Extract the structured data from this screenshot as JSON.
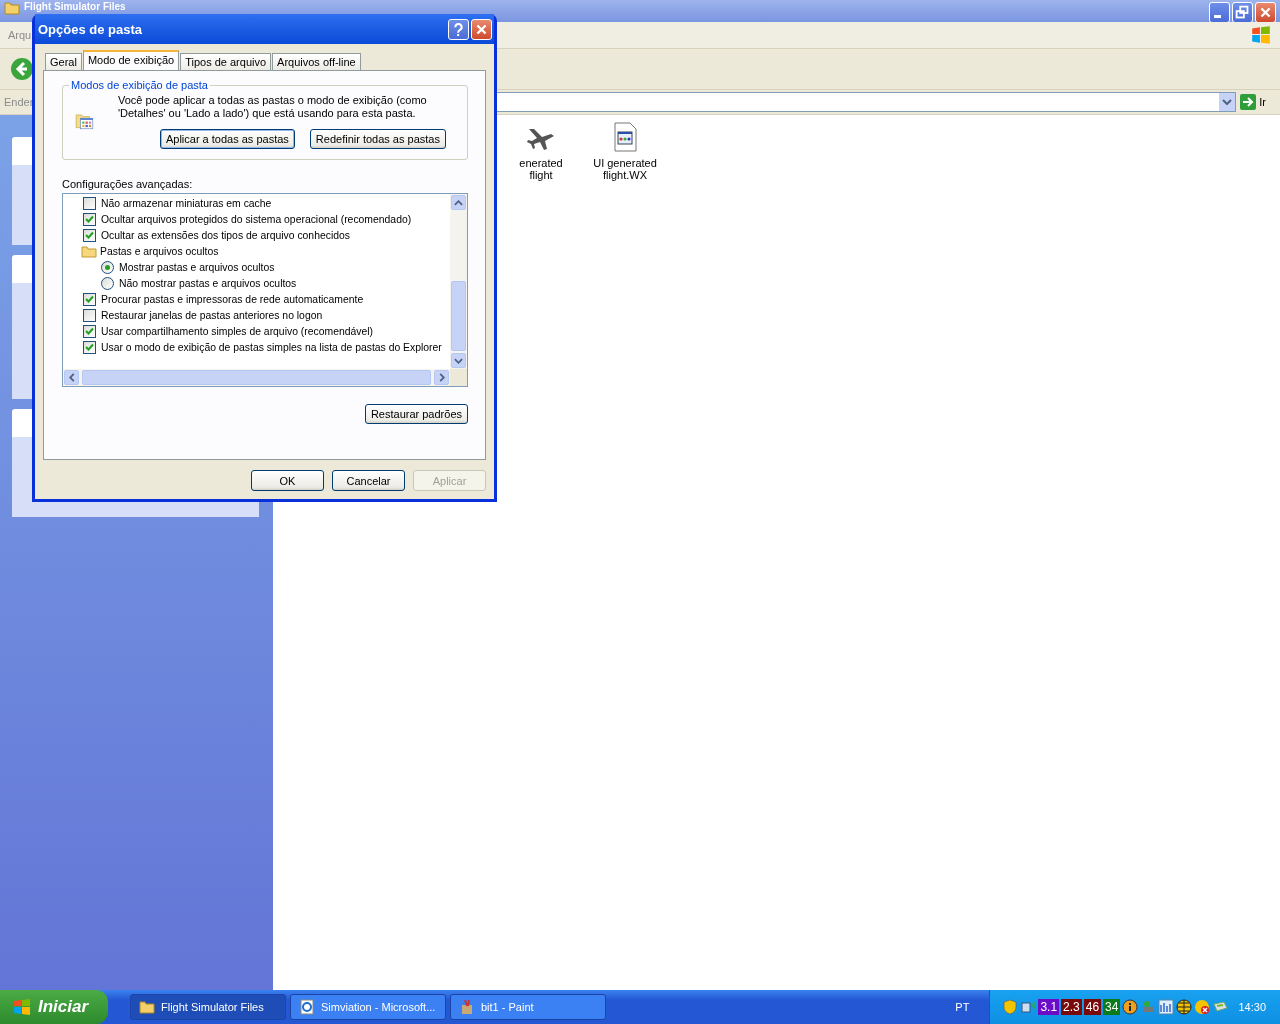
{
  "explorer": {
    "title": "Flight Simulator Files",
    "menu_fragment": "Arqu",
    "address_label": "Ender",
    "go_label": "Ir",
    "files": [
      {
        "name": "enerated flight",
        "kind": "plane"
      },
      {
        "name": "UI generated flight.WX",
        "kind": "document"
      }
    ]
  },
  "dialog": {
    "title": "Opções de pasta",
    "tabs": [
      {
        "label": "Geral",
        "selected": false
      },
      {
        "label": "Modo de exibição",
        "selected": true
      },
      {
        "label": "Tipos de arquivo",
        "selected": false
      },
      {
        "label": "Arquivos off-line",
        "selected": false
      }
    ],
    "group_title": "Modos de exibição de pasta",
    "group_text": "Você pode aplicar a todas as pastas o modo de exibição (como 'Detalhes' ou 'Lado a lado') que está usando para esta pasta.",
    "group_buttons": [
      {
        "label": "Aplicar a todas as pastas",
        "default": true
      },
      {
        "label": "Redefinir todas as pastas",
        "default": false
      }
    ],
    "advanced_label": "Configurações avançadas:",
    "settings": [
      {
        "kind": "checkbox",
        "label": "Não armazenar miniaturas em cache",
        "checked": false
      },
      {
        "kind": "checkbox",
        "label": "Ocultar arquivos protegidos do sistema operacional (recomendado)",
        "checked": true
      },
      {
        "kind": "checkbox",
        "label": "Ocultar as extensões dos tipos de arquivo conhecidos",
        "checked": true
      },
      {
        "kind": "folder",
        "label": "Pastas e arquivos ocultos",
        "children": [
          {
            "kind": "radio",
            "label": "Mostrar pastas e arquivos ocultos",
            "selected": true
          },
          {
            "kind": "radio",
            "label": "Não mostrar pastas e arquivos ocultos",
            "selected": false
          }
        ]
      },
      {
        "kind": "checkbox",
        "label": "Procurar pastas e impressoras de rede automaticamente",
        "checked": true
      },
      {
        "kind": "checkbox",
        "label": "Restaurar janelas de pastas anteriores no logon",
        "checked": false
      },
      {
        "kind": "checkbox",
        "label": "Usar compartilhamento simples de arquivo (recomendável)",
        "checked": true
      },
      {
        "kind": "checkbox",
        "label": "Usar o modo de exibição de pastas simples na lista de pastas do Explorer",
        "checked": true
      }
    ],
    "restore_button": "Restaurar padrões",
    "buttons": [
      {
        "label": "OK",
        "disabled": false
      },
      {
        "label": "Cancelar",
        "disabled": false
      },
      {
        "label": "Aplicar",
        "disabled": true
      }
    ]
  },
  "taskbar": {
    "start": "Iniciar",
    "tasks": [
      {
        "label": "Flight Simulator Files",
        "kind": "folder",
        "selected": true
      },
      {
        "label": "Simviation - Microsoft...",
        "kind": "browser",
        "selected": false
      },
      {
        "label": "bit1 - Paint",
        "kind": "paint",
        "selected": false
      }
    ],
    "language": "PT",
    "tray_badges": [
      {
        "text": "3.1",
        "color": "#6a0cc8"
      },
      {
        "text": "2.3",
        "color": "#7a0a0a"
      },
      {
        "text": "46",
        "color": "#7a0a0a"
      },
      {
        "text": "34",
        "color": "#0a7a1a"
      }
    ],
    "clock": "14:30"
  }
}
